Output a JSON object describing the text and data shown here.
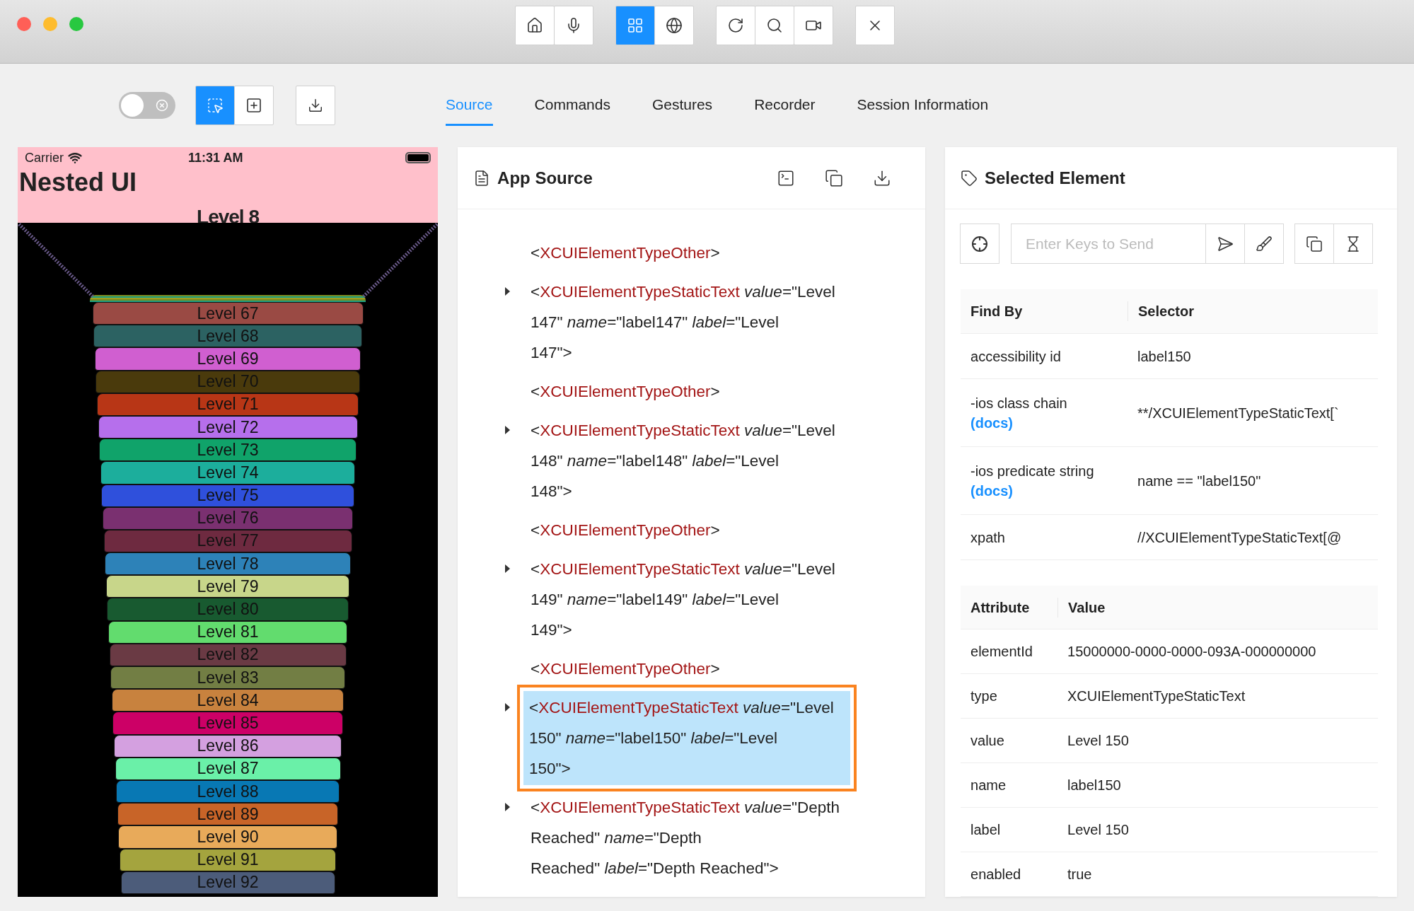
{
  "title_bar": {
    "groups": [
      [
        {
          "selected": false
        },
        {
          "selected": false
        }
      ],
      [
        {
          "selected": true
        },
        {
          "selected": false
        }
      ],
      [
        {
          "selected": false
        },
        {
          "selected": false
        },
        {
          "selected": false
        }
      ],
      [
        {
          "selected": false
        }
      ]
    ]
  },
  "toolbar": {
    "toggle_on": false,
    "modes": [
      {
        "selected": true
      },
      {
        "selected": false
      }
    ]
  },
  "tabs": [
    {
      "label": "Source",
      "selected": true
    },
    {
      "label": "Commands",
      "selected": false
    },
    {
      "label": "Gestures",
      "selected": false
    },
    {
      "label": "Recorder",
      "selected": false
    },
    {
      "label": "Session Information",
      "selected": false
    }
  ],
  "device": {
    "carrier": "Carrier",
    "time": "11:31 AM",
    "title": "Nested UI",
    "overlap_label": "Level 8",
    "levels": [
      {
        "label": "Level 67",
        "color": "#9a4a44"
      },
      {
        "label": "Level 68",
        "color": "#2c6262"
      },
      {
        "label": "Level 69",
        "color": "#d05fd0"
      },
      {
        "label": "Level 70",
        "color": "#4a3a0c"
      },
      {
        "label": "Level 71",
        "color": "#b83616"
      },
      {
        "label": "Level 72",
        "color": "#b66fec"
      },
      {
        "label": "Level 73",
        "color": "#10a36a"
      },
      {
        "label": "Level 74",
        "color": "#1cae9c"
      },
      {
        "label": "Level 75",
        "color": "#2f50dc"
      },
      {
        "label": "Level 76",
        "color": "#7a3070"
      },
      {
        "label": "Level 77",
        "color": "#6e2a40"
      },
      {
        "label": "Level 78",
        "color": "#2d82b8"
      },
      {
        "label": "Level 79",
        "color": "#c8d68a"
      },
      {
        "label": "Level 80",
        "color": "#185a30"
      },
      {
        "label": "Level 81",
        "color": "#62dc6e"
      },
      {
        "label": "Level 82",
        "color": "#6a3a44"
      },
      {
        "label": "Level 83",
        "color": "#727e44"
      },
      {
        "label": "Level 84",
        "color": "#c8823e"
      },
      {
        "label": "Level 85",
        "color": "#cc0066"
      },
      {
        "label": "Level 86",
        "color": "#d4a0e0"
      },
      {
        "label": "Level 87",
        "color": "#6af0a8"
      },
      {
        "label": "Level 88",
        "color": "#0878b4"
      },
      {
        "label": "Level 89",
        "color": "#c86428"
      },
      {
        "label": "Level 90",
        "color": "#e8aa5a"
      },
      {
        "label": "Level 91",
        "color": "#a4a43e"
      },
      {
        "label": "Level 92",
        "color": "#4c5c7a"
      }
    ]
  },
  "source": {
    "title": "App Source",
    "nodes": [
      {
        "open": "<",
        "tag": "XCUIElementTypeOther",
        "rest": ">",
        "expandable": false,
        "selected": false
      },
      {
        "open": "<",
        "tag": "XCUIElementTypeStaticText",
        "rest": " *value*=\"Level\n147\" *name*=\"label147\" *label*=\"Level\n147\">",
        "expandable": true,
        "selected": false
      },
      {
        "open": "<",
        "tag": "XCUIElementTypeOther",
        "rest": ">",
        "expandable": false,
        "selected": false
      },
      {
        "open": "<",
        "tag": "XCUIElementTypeStaticText",
        "rest": " *value*=\"Level\n148\" *name*=\"label148\" *label*=\"Level\n148\">",
        "expandable": true,
        "selected": false
      },
      {
        "open": "<",
        "tag": "XCUIElementTypeOther",
        "rest": ">",
        "expandable": false,
        "selected": false
      },
      {
        "open": "<",
        "tag": "XCUIElementTypeStaticText",
        "rest": " *value*=\"Level\n149\" *name*=\"label149\" *label*=\"Level\n149\">",
        "expandable": true,
        "selected": false
      },
      {
        "open": "<",
        "tag": "XCUIElementTypeOther",
        "rest": ">",
        "expandable": false,
        "selected": false
      },
      {
        "open": "<",
        "tag": "XCUIElementTypeStaticText",
        "rest": " *value*=\"Level\n150\" *name*=\"label150\" *label*=\"Level\n150\">",
        "expandable": true,
        "selected": true
      },
      {
        "open": "<",
        "tag": "XCUIElementTypeStaticText",
        "rest": " *value*=\"Depth\nReached\" *name*=\"Depth\nReached\" *label*=\"Depth Reached\">",
        "expandable": true,
        "selected": false
      }
    ]
  },
  "selected_element": {
    "title": "Selected Element",
    "keys_placeholder": "Enter Keys to Send",
    "find_by": {
      "columns": [
        "Find By",
        "Selector"
      ],
      "rows": [
        {
          "find_by": "accessibility id",
          "selector": "label150"
        },
        {
          "find_by": "-ios class chain",
          "docs": "(docs)",
          "selector": "**/XCUIElementTypeStaticText[`"
        },
        {
          "find_by": "-ios predicate string",
          "docs": "(docs)",
          "selector": "name == \"label150\""
        },
        {
          "find_by": "xpath",
          "selector": "//XCUIElementTypeStaticText[@"
        }
      ]
    },
    "attributes": {
      "columns": [
        "Attribute",
        "Value"
      ],
      "rows": [
        {
          "attribute": "elementId",
          "value": "15000000-0000-0000-093A-000000000"
        },
        {
          "attribute": "type",
          "value": "XCUIElementTypeStaticText"
        },
        {
          "attribute": "value",
          "value": "Level 150"
        },
        {
          "attribute": "name",
          "value": "label150"
        },
        {
          "attribute": "label",
          "value": "Level 150"
        },
        {
          "attribute": "enabled",
          "value": "true"
        }
      ]
    }
  }
}
